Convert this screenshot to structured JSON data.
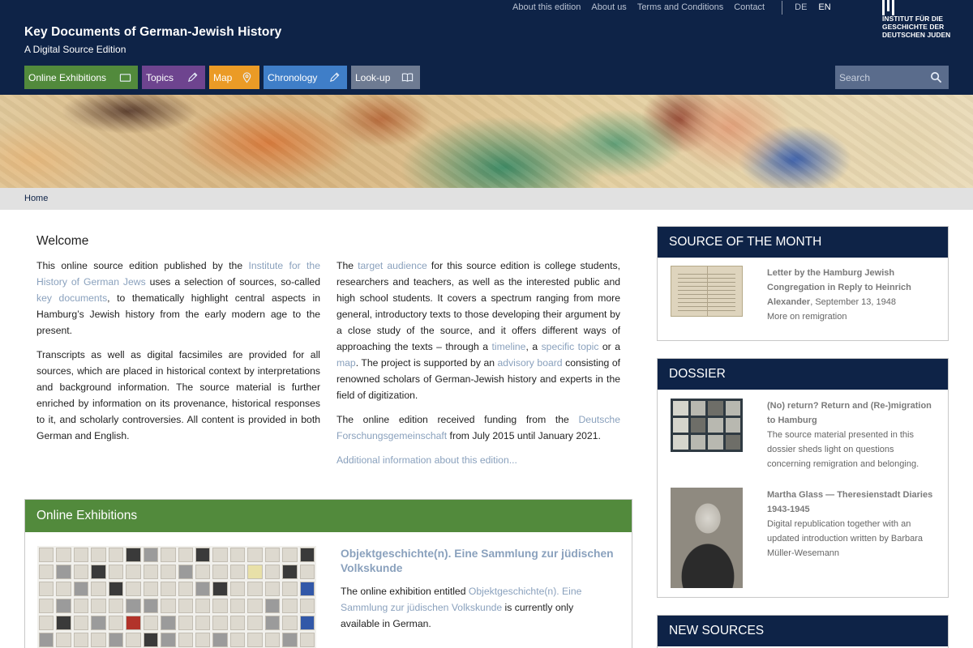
{
  "header": {
    "top_links": [
      "About this edition",
      "About us",
      "Terms and Conditions",
      "Contact"
    ],
    "languages": [
      {
        "code": "DE",
        "active": false
      },
      {
        "code": "EN",
        "active": true
      }
    ],
    "site_title": "Key Documents of German-Jewish History",
    "site_subtitle": "A Digital Source Edition",
    "logo_lines": [
      "INSTITUT FÜR DIE",
      "GESCHICHTE DER",
      "DEUTSCHEN JUDEN"
    ],
    "nav": [
      {
        "label": "Online Exhibitions",
        "icon": "exhibition-icon",
        "color": "#528a3c"
      },
      {
        "label": "Topics",
        "icon": "pencil-icon",
        "color": "#6e448f"
      },
      {
        "label": "Map",
        "icon": "map-pin-icon",
        "color": "#eb9b26"
      },
      {
        "label": "Chronology",
        "icon": "pencil-icon",
        "color": "#3f7ec8"
      },
      {
        "label": "Look-up",
        "icon": "book-icon",
        "color": "#6e7b92"
      }
    ],
    "search_placeholder": "Search"
  },
  "breadcrumb": {
    "home": "Home"
  },
  "welcome": {
    "title": "Welcome",
    "col1": {
      "p1": [
        "This online source edition published by the ",
        "Institute for the History of German Jews",
        " uses a selection of sources, so-called ",
        "key documents",
        ", to thematically highlight central aspects in Hamburg’s Jewish history from the early modern age to the present."
      ],
      "p2": "Transcripts as well as digital facsimiles are provided for all sources, which are placed in historical context by interpreta­tions and background information. The source material is fur­ther enriched by information on its provenance, historical re­sponses to it, and scholarly controversies. All content is pro­vided in both German and English."
    },
    "col2": {
      "p1": [
        "The ",
        "target audience",
        " for this source edition is college students, researchers and teachers, as well as the interested public and high school students. It covers a spectrum ranging from more general, introductory texts to those developing their argument by a close study of the source, and it offers different ways of approaching the texts – through a ",
        "timeline",
        ", a ",
        "specific topic",
        " or a ",
        "map",
        ". The project is supported by an ",
        "advisory board",
        " consisting of renowned scholars of German-Jewish history and experts in the field of digitization."
      ],
      "p2": [
        "The online edition received funding from the ",
        "Deutsche Forschungsgemeinschaft",
        " from July 2015 until January 2021."
      ],
      "more": "Additional information about this edition..."
    }
  },
  "online_exhibitions": {
    "heading": "Online Exhibitions",
    "item_title": "Objektgeschichte(n). Eine Sammlung zur jüdischen Volkskunde",
    "text": [
      "The online exhibition entitled ",
      "Objektgeschichte(n). Eine Sammlung zur jüdischen Volkskunde",
      " is currently only available in German."
    ]
  },
  "sidebar": {
    "source_of_month": {
      "heading": "Source of the Month",
      "title": "Letter by the Hamburg Jewish Congregation in Reply to Heinrich Alexander",
      "date": ", September 13, 1948",
      "more": "More on remigration"
    },
    "dossier": {
      "heading": "Dossier",
      "items": [
        {
          "title": "(No) return? Return and (Re-)migration to Hamburg",
          "text": "The source material presented in this dossier sheds light on questions concerning remigration and belonging."
        },
        {
          "title": "Martha Glass — Theresienstadt Diaries 1943-1945",
          "text": "Digital republication together with an updated introduction written by Barbara Müller-Wesemann"
        }
      ]
    },
    "new_sources": {
      "heading": "New Sources"
    }
  },
  "colors": {
    "navy": "#0e2347",
    "green": "#528a3c",
    "link": "#8aa1bd",
    "breadcrumb_bg": "#e1e1e1"
  }
}
